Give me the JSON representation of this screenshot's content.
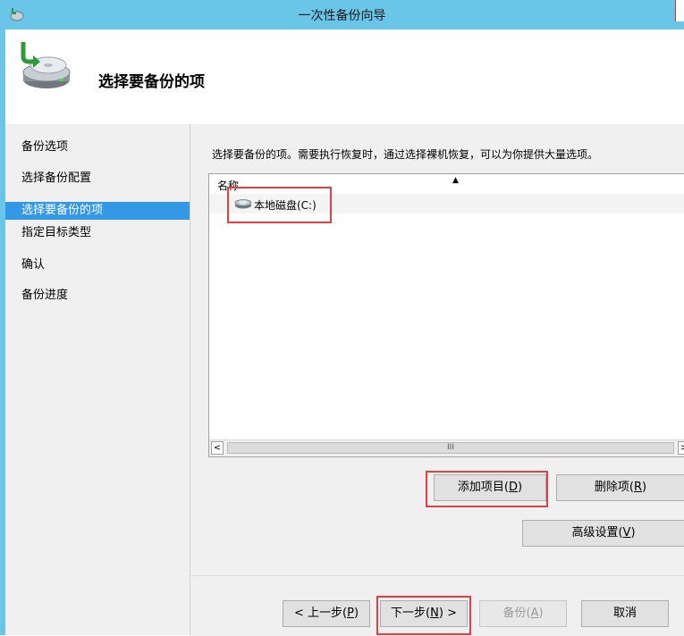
{
  "window": {
    "title": "一次性备份向导"
  },
  "header": {
    "title": "选择要备份的项"
  },
  "sidebar": {
    "items": [
      {
        "label": "备份选项",
        "active": false
      },
      {
        "label": "选择备份配置",
        "active": false
      },
      {
        "label": "选择要备份的项",
        "active": true
      },
      {
        "label": "指定目标类型",
        "active": false
      },
      {
        "label": "确认",
        "active": false
      },
      {
        "label": "备份进度",
        "active": false
      }
    ]
  },
  "main": {
    "instruction": "选择要备份的项。需要执行恢复时，通过选择裸机恢复，可以为你提供大量选项。",
    "list": {
      "column": "名称",
      "items": [
        {
          "label": "本地磁盘(C:)",
          "icon": "disk-icon"
        }
      ],
      "scroll_thumb": "III"
    },
    "buttons": {
      "add": "添加项目",
      "add_key": "D",
      "remove": "删除项",
      "remove_key": "R",
      "advanced": "高级设置",
      "advanced_key": "V"
    }
  },
  "footer": {
    "prev": "< 上一步",
    "prev_key": "P",
    "next": "下一步",
    "next_key": "N",
    "next_suffix": " >",
    "backup": "备份",
    "backup_key": "A",
    "cancel": "取消"
  },
  "colors": {
    "titlebar": "#6ac6e8",
    "selection": "#3399e6",
    "highlight": "#e04040"
  }
}
